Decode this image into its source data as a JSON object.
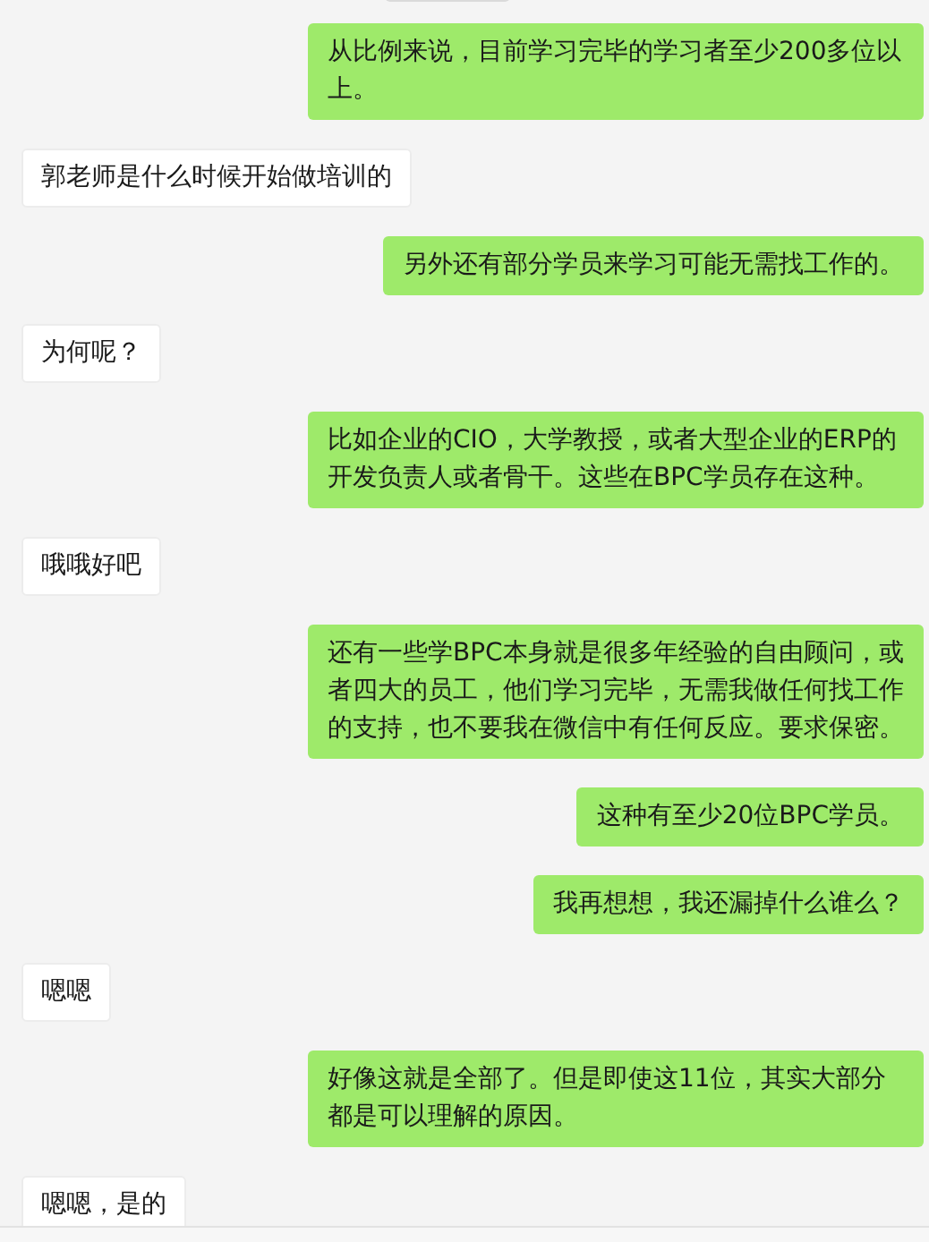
{
  "messages": [
    {
      "kind": "sent",
      "text": "从比例来说，目前学习完毕的学习者至少200多位以上。"
    },
    {
      "kind": "received",
      "text": "郭老师是什么时候开始做培训的"
    },
    {
      "kind": "sent",
      "text": "另外还有部分学员来学习可能无需找工作的。"
    },
    {
      "kind": "received",
      "text": "为何呢？"
    },
    {
      "kind": "sent",
      "text": "比如企业的CIO，大学教授，或者大型企业的ERP的开发负责人或者骨干。这些在BPC学员存在这种。"
    },
    {
      "kind": "received",
      "text": "哦哦好吧"
    },
    {
      "kind": "sent",
      "text": "还有一些学BPC本身就是很多年经验的自由顾问，或者四大的员工，他们学习完毕，无需我做任何找工作的支持，也不要我在微信中有任何反应。要求保密。"
    },
    {
      "kind": "sent",
      "text": "这种有至少20位BPC学员。"
    },
    {
      "kind": "sent",
      "text": "我再想想，我还漏掉什么谁么？"
    },
    {
      "kind": "received",
      "text": "嗯嗯"
    },
    {
      "kind": "sent",
      "text": "好像这就是全部了。但是即使这11位，其实大部分都是可以理解的原因。"
    },
    {
      "kind": "received",
      "text": "嗯嗯，是的"
    }
  ]
}
